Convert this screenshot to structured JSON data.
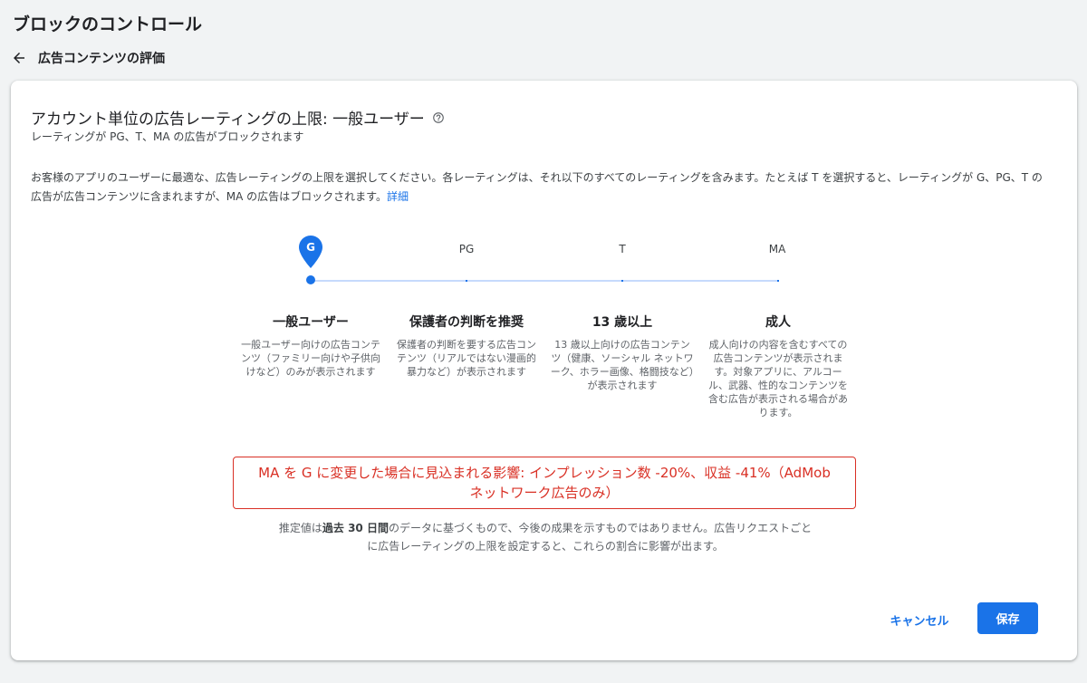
{
  "header": {
    "title": "ブロックのコントロール",
    "back_label": "広告コンテンツの評価"
  },
  "card": {
    "heading": "アカウント単位の広告レーティングの上限: 一般ユーザー",
    "subheading": "レーティングが PG、T、MA の広告がブロックされます",
    "description": "お客様のアプリのユーザーに最適な、広告レーティングの上限を選択してください。各レーティングは、それ以下のすべてのレーティングを含みます。たとえば T を選択すると、レーティングが G、PG、T の広告が広告コンテンツに含まれますが、MA の広告はブロックされます。",
    "details_link": "詳細"
  },
  "slider": {
    "selected": "G",
    "steps": [
      "G",
      "PG",
      "T",
      "MA"
    ]
  },
  "levels": [
    {
      "title": "一般ユーザー",
      "desc": "一般ユーザー向けの広告コンテンツ（ファミリー向けや子供向けなど）のみが表示されます"
    },
    {
      "title": "保護者の判断を推奨",
      "desc": "保護者の判断を要する広告コンテンツ（リアルではない漫画的暴力など）が表示されます"
    },
    {
      "title": "13 歳以上",
      "desc": "13 歳以上向けの広告コンテンツ（健康、ソーシャル ネットワーク、ホラー画像、格闘技など）が表示されます"
    },
    {
      "title": "成人",
      "desc": "成人向けの内容を含むすべての広告コンテンツが表示されます。対象アプリに、アルコール、武器、性的なコンテンツを含む広告が表示される場合があります。"
    }
  ],
  "impact": {
    "text": "MA を G に変更した場合に見込まれる影響: インプレッション数 -20%、収益 -41%（AdMob ネットワーク広告のみ）"
  },
  "note": {
    "before": "推定値は",
    "bold": "過去 30 日間",
    "after": "のデータに基づくもので、今後の成果を示すものではありません。広告リクエストごとに広告レーティングの上限を設定すると、これらの割合に影響が出ます。"
  },
  "actions": {
    "cancel_label": "キャンセル",
    "save_label": "保存"
  },
  "colors": {
    "accent": "#1a73e8",
    "error": "#d93025",
    "track": "#c6dafc"
  },
  "icons": {
    "back": "arrow-back-icon",
    "help": "help-circle-icon",
    "pin": "map-pin-icon"
  }
}
